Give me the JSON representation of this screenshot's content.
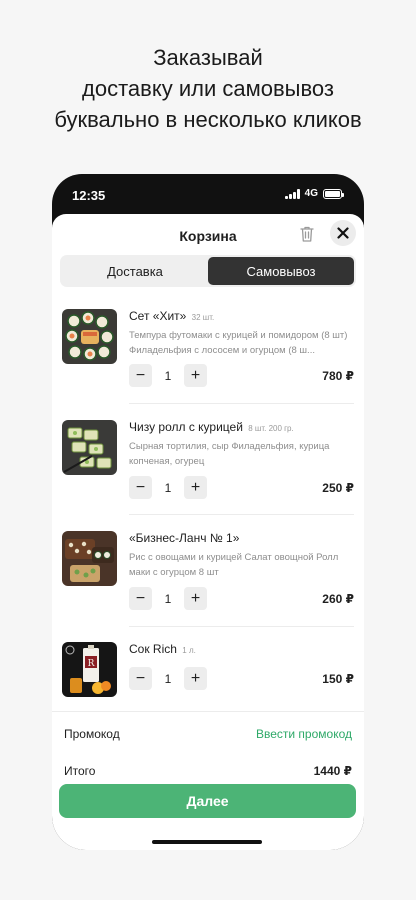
{
  "headline": {
    "line1": "Заказывай",
    "line2": "доставку или самовывоз",
    "line3": "буквально в несколько кликов"
  },
  "statusbar": {
    "time": "12:35",
    "network": "4G"
  },
  "sheet": {
    "title": "Корзина"
  },
  "tabs": [
    {
      "label": "Доставка",
      "active": false
    },
    {
      "label": "Самовывоз",
      "active": true
    }
  ],
  "items": [
    {
      "title": "Сет «Хит»",
      "meta": "32 шт.",
      "description": "Темпура футомаки с курицей и помидором (8 шт) Филадельфия с лососем и огурцом (8 ш...",
      "quantity": "1",
      "price": "780 ₽"
    },
    {
      "title": "Чизу ролл с курицей",
      "meta": "8 шт. 200 гр.",
      "description": "Сырная тортилия, сыр Филадельфия, курица копченая, огурец",
      "quantity": "1",
      "price": "250 ₽"
    },
    {
      "title": "«Бизнес-Ланч № 1»",
      "meta": "",
      "description": "Рис с овощами и курицей Салат овощной Ролл маки с огурцом 8 шт",
      "quantity": "1",
      "price": "260 ₽"
    },
    {
      "title": "Сок Rich",
      "meta": "1 л.",
      "description": "",
      "quantity": "1",
      "price": "150 ₽"
    }
  ],
  "stepper": {
    "minus": "−",
    "plus": "+"
  },
  "promo": {
    "label": "Промокод",
    "action": "Ввести промокод"
  },
  "total": {
    "label": "Итого",
    "value": "1440 ₽"
  },
  "cta": {
    "label": "Далее"
  },
  "colors": {
    "accent": "#4cb476",
    "link": "#2ea968",
    "active_tab": "#333333"
  }
}
